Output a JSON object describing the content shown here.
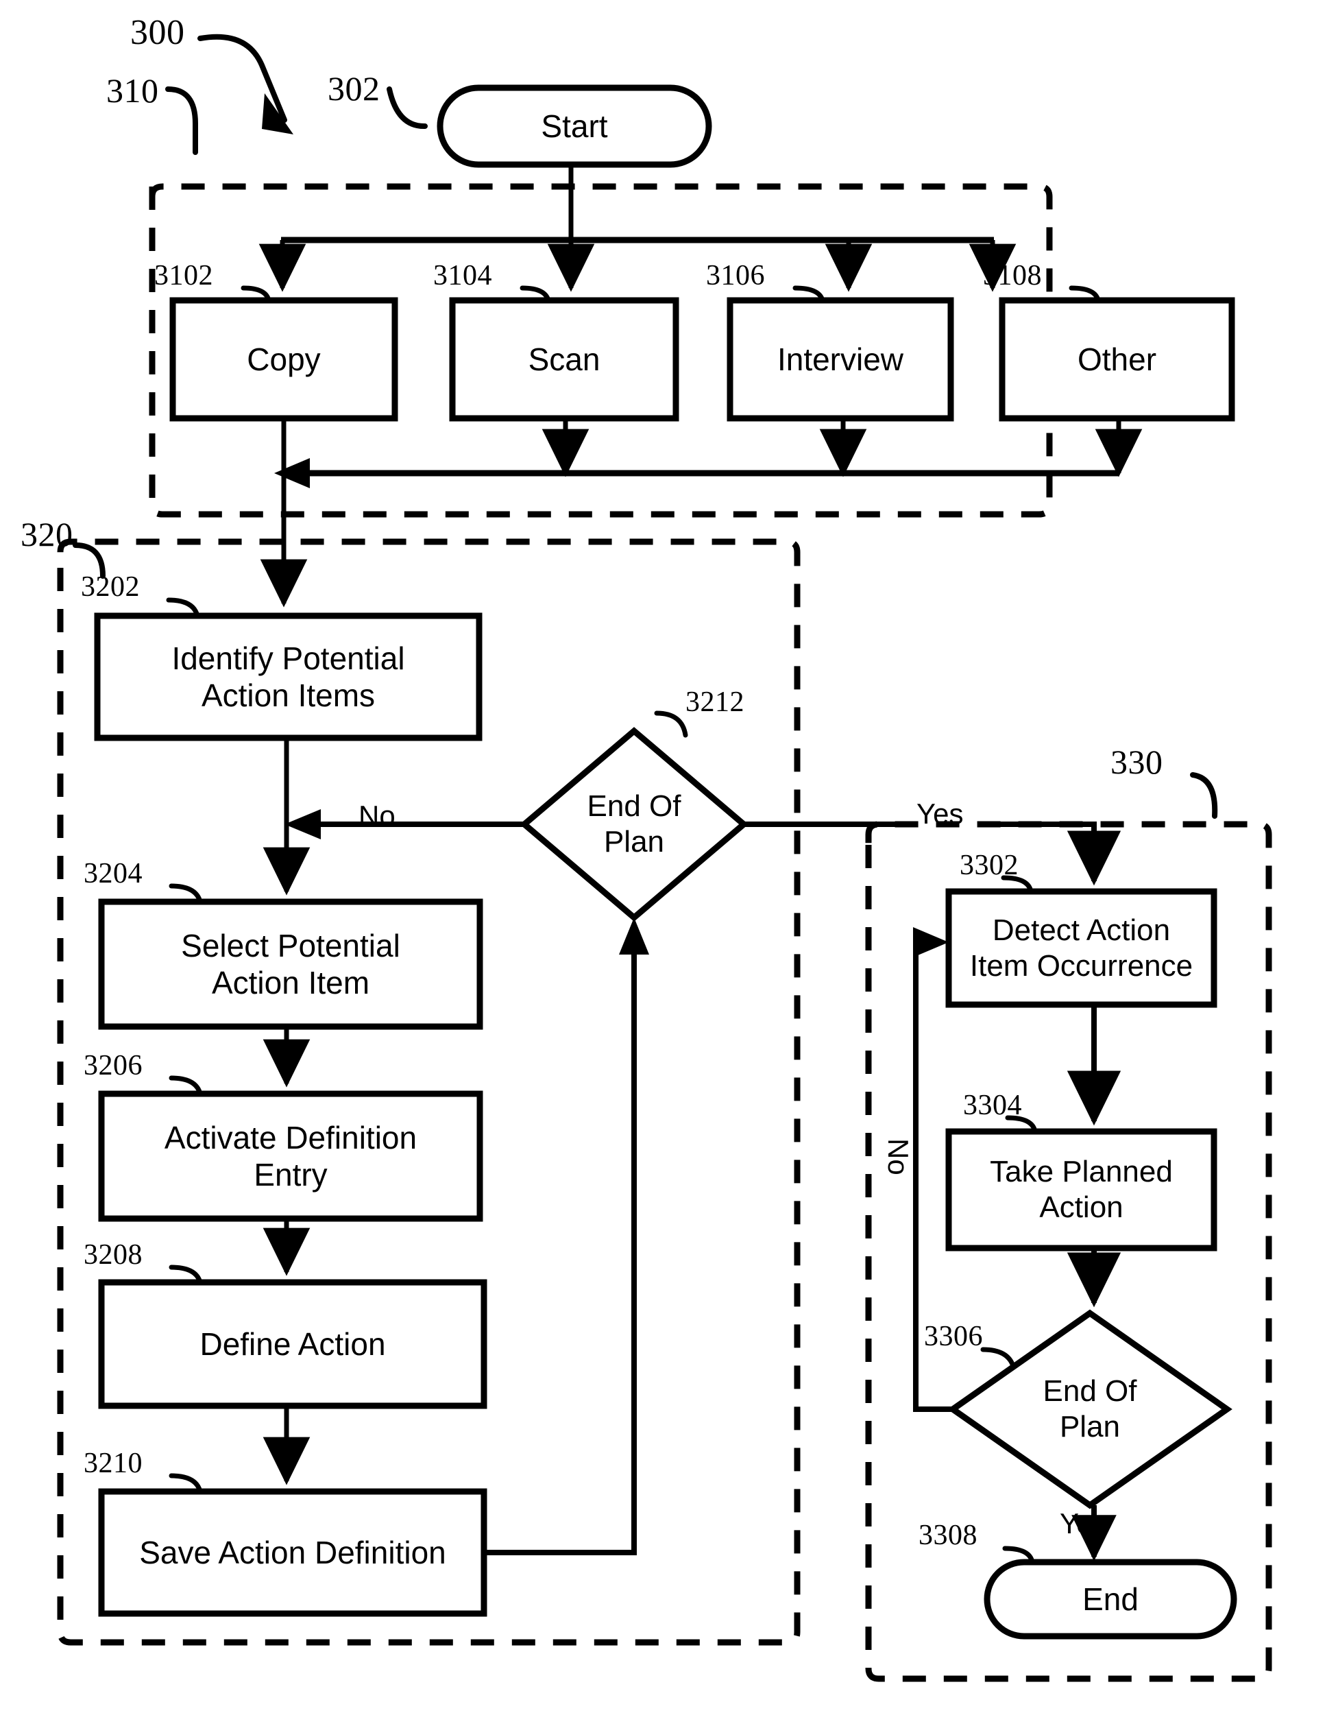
{
  "figure": {
    "id": "300",
    "title_refs": [
      "300",
      "302",
      "310",
      "320",
      "330"
    ]
  },
  "refs": {
    "main": "300",
    "start": "302",
    "group_capture": "310",
    "capture_copy": "3102",
    "capture_scan": "3104",
    "capture_interview": "3106",
    "capture_other": "3108",
    "group_plan": "320",
    "identify": "3202",
    "select": "3204",
    "activate": "3206",
    "define": "3208",
    "save": "3210",
    "end_of_plan_1": "3212",
    "group_execute": "330",
    "detect": "3302",
    "take": "3304",
    "end_of_plan_2": "3306",
    "end": "3308"
  },
  "nodes": {
    "start": {
      "label": "Start",
      "shape": "terminator"
    },
    "copy": {
      "label": "Copy",
      "shape": "process"
    },
    "scan": {
      "label": "Scan",
      "shape": "process"
    },
    "interview": {
      "label": "Interview",
      "shape": "process"
    },
    "other": {
      "label": "Other",
      "shape": "process"
    },
    "identify": {
      "label": "Identify Potential\nAction Items",
      "shape": "process"
    },
    "select": {
      "label": "Select Potential\nAction Item",
      "shape": "process"
    },
    "activate": {
      "label": "Activate Definition\nEntry",
      "shape": "process"
    },
    "define": {
      "label": "Define Action",
      "shape": "process"
    },
    "save": {
      "label": "Save Action Definition",
      "shape": "process"
    },
    "end_of_plan_1": {
      "label": "End Of\nPlan",
      "shape": "decision"
    },
    "detect": {
      "label": "Detect Action\nItem Occurrence",
      "shape": "process"
    },
    "take": {
      "label": "Take Planned\nAction",
      "shape": "process"
    },
    "end_of_plan_2": {
      "label": "End Of\nPlan",
      "shape": "decision"
    },
    "end": {
      "label": "End",
      "shape": "terminator"
    }
  },
  "edge_labels": {
    "no_plan": "No",
    "yes_plan": "Yes",
    "no_execute": "No",
    "yes_execute": "Yes"
  },
  "colors": {
    "stroke": "#000000",
    "fill": "#ffffff",
    "background": "#ffffff"
  }
}
